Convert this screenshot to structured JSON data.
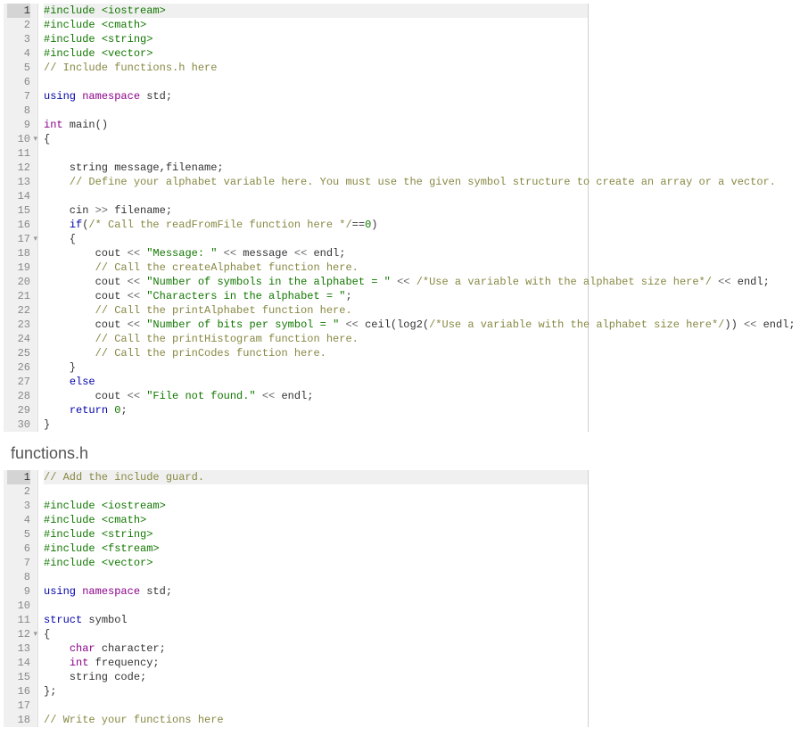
{
  "section2_title": "functions.h",
  "editor1": {
    "lines": [
      {
        "n": "1",
        "active": true,
        "tokens": [
          {
            "t": "#include",
            "c": "pre"
          },
          {
            "t": " "
          },
          {
            "t": "<iostream>",
            "c": "pre"
          }
        ]
      },
      {
        "n": "2",
        "tokens": [
          {
            "t": "#include",
            "c": "pre"
          },
          {
            "t": " "
          },
          {
            "t": "<cmath>",
            "c": "pre"
          }
        ]
      },
      {
        "n": "3",
        "tokens": [
          {
            "t": "#include",
            "c": "pre"
          },
          {
            "t": " "
          },
          {
            "t": "<string>",
            "c": "pre"
          }
        ]
      },
      {
        "n": "4",
        "tokens": [
          {
            "t": "#include",
            "c": "pre"
          },
          {
            "t": " "
          },
          {
            "t": "<vector>",
            "c": "pre"
          }
        ]
      },
      {
        "n": "5",
        "tokens": [
          {
            "t": "// Include functions.h here",
            "c": "cmt"
          }
        ]
      },
      {
        "n": "6",
        "tokens": []
      },
      {
        "n": "7",
        "tokens": [
          {
            "t": "using",
            "c": "kw"
          },
          {
            "t": " "
          },
          {
            "t": "namespace",
            "c": "kw2"
          },
          {
            "t": " std;"
          }
        ]
      },
      {
        "n": "8",
        "tokens": []
      },
      {
        "n": "9",
        "tokens": [
          {
            "t": "int",
            "c": "type"
          },
          {
            "t": " main()"
          }
        ]
      },
      {
        "n": "10",
        "fold": true,
        "tokens": [
          {
            "t": "{"
          }
        ]
      },
      {
        "n": "11",
        "tokens": []
      },
      {
        "n": "12",
        "tokens": [
          {
            "t": "    string message,filename;"
          }
        ]
      },
      {
        "n": "13",
        "tokens": [
          {
            "t": "    "
          },
          {
            "t": "// Define your alphabet variable here. You must use the given symbol structure to create an array or a vector.",
            "c": "cmt"
          }
        ]
      },
      {
        "n": "14",
        "tokens": []
      },
      {
        "n": "15",
        "tokens": [
          {
            "t": "    cin "
          },
          {
            "t": ">>",
            "c": "op"
          },
          {
            "t": " filename;"
          }
        ]
      },
      {
        "n": "16",
        "tokens": [
          {
            "t": "    "
          },
          {
            "t": "if",
            "c": "kw"
          },
          {
            "t": "("
          },
          {
            "t": "/* Call the readFromFile function here */",
            "c": "cmt"
          },
          {
            "t": "=="
          },
          {
            "t": "0",
            "c": "num"
          },
          {
            "t": ")"
          }
        ]
      },
      {
        "n": "17",
        "fold": true,
        "tokens": [
          {
            "t": "    {"
          }
        ]
      },
      {
        "n": "18",
        "tokens": [
          {
            "t": "        cout "
          },
          {
            "t": "<<",
            "c": "op"
          },
          {
            "t": " "
          },
          {
            "t": "\"Message: \"",
            "c": "str"
          },
          {
            "t": " "
          },
          {
            "t": "<<",
            "c": "op"
          },
          {
            "t": " message "
          },
          {
            "t": "<<",
            "c": "op"
          },
          {
            "t": " endl;"
          }
        ]
      },
      {
        "n": "19",
        "tokens": [
          {
            "t": "        "
          },
          {
            "t": "// Call the createAlphabet function here.",
            "c": "cmt"
          }
        ]
      },
      {
        "n": "20",
        "tokens": [
          {
            "t": "        cout "
          },
          {
            "t": "<<",
            "c": "op"
          },
          {
            "t": " "
          },
          {
            "t": "\"Number of symbols in the alphabet = \"",
            "c": "str"
          },
          {
            "t": " "
          },
          {
            "t": "<<",
            "c": "op"
          },
          {
            "t": " "
          },
          {
            "t": "/*Use a variable with the alphabet size here*/",
            "c": "cmt"
          },
          {
            "t": " "
          },
          {
            "t": "<<",
            "c": "op"
          },
          {
            "t": " endl;"
          }
        ]
      },
      {
        "n": "21",
        "tokens": [
          {
            "t": "        cout "
          },
          {
            "t": "<<",
            "c": "op"
          },
          {
            "t": " "
          },
          {
            "t": "\"Characters in the alphabet = \"",
            "c": "str"
          },
          {
            "t": ";"
          }
        ]
      },
      {
        "n": "22",
        "tokens": [
          {
            "t": "        "
          },
          {
            "t": "// Call the printAlphabet function here.",
            "c": "cmt"
          }
        ]
      },
      {
        "n": "23",
        "tokens": [
          {
            "t": "        cout "
          },
          {
            "t": "<<",
            "c": "op"
          },
          {
            "t": " "
          },
          {
            "t": "\"Number of bits per symbol = \"",
            "c": "str"
          },
          {
            "t": " "
          },
          {
            "t": "<<",
            "c": "op"
          },
          {
            "t": " ceil(log2("
          },
          {
            "t": "/*Use a variable with the alphabet size here*/",
            "c": "cmt"
          },
          {
            "t": ")) "
          },
          {
            "t": "<<",
            "c": "op"
          },
          {
            "t": " endl;"
          }
        ]
      },
      {
        "n": "24",
        "tokens": [
          {
            "t": "        "
          },
          {
            "t": "// Call the printHistogram function here.",
            "c": "cmt"
          }
        ]
      },
      {
        "n": "25",
        "tokens": [
          {
            "t": "        "
          },
          {
            "t": "// Call the prinCodes function here.",
            "c": "cmt"
          }
        ]
      },
      {
        "n": "26",
        "tokens": [
          {
            "t": "    }"
          }
        ]
      },
      {
        "n": "27",
        "tokens": [
          {
            "t": "    "
          },
          {
            "t": "else",
            "c": "kw"
          }
        ]
      },
      {
        "n": "28",
        "tokens": [
          {
            "t": "        cout "
          },
          {
            "t": "<<",
            "c": "op"
          },
          {
            "t": " "
          },
          {
            "t": "\"File not found.\"",
            "c": "str"
          },
          {
            "t": " "
          },
          {
            "t": "<<",
            "c": "op"
          },
          {
            "t": " endl;"
          }
        ]
      },
      {
        "n": "29",
        "tokens": [
          {
            "t": "    "
          },
          {
            "t": "return",
            "c": "kw"
          },
          {
            "t": " "
          },
          {
            "t": "0",
            "c": "num"
          },
          {
            "t": ";"
          }
        ]
      },
      {
        "n": "30",
        "tokens": [
          {
            "t": "}"
          }
        ]
      }
    ]
  },
  "editor2": {
    "lines": [
      {
        "n": "1",
        "active": true,
        "tokens": [
          {
            "t": "// Add the include guard.",
            "c": "cmt"
          }
        ]
      },
      {
        "n": "2",
        "tokens": []
      },
      {
        "n": "3",
        "tokens": [
          {
            "t": "#include",
            "c": "pre"
          },
          {
            "t": " "
          },
          {
            "t": "<iostream>",
            "c": "pre"
          }
        ]
      },
      {
        "n": "4",
        "tokens": [
          {
            "t": "#include",
            "c": "pre"
          },
          {
            "t": " "
          },
          {
            "t": "<cmath>",
            "c": "pre"
          }
        ]
      },
      {
        "n": "5",
        "tokens": [
          {
            "t": "#include",
            "c": "pre"
          },
          {
            "t": " "
          },
          {
            "t": "<string>",
            "c": "pre"
          }
        ]
      },
      {
        "n": "6",
        "tokens": [
          {
            "t": "#include",
            "c": "pre"
          },
          {
            "t": " "
          },
          {
            "t": "<fstream>",
            "c": "pre"
          }
        ]
      },
      {
        "n": "7",
        "tokens": [
          {
            "t": "#include",
            "c": "pre"
          },
          {
            "t": " "
          },
          {
            "t": "<vector>",
            "c": "pre"
          }
        ]
      },
      {
        "n": "8",
        "tokens": []
      },
      {
        "n": "9",
        "tokens": [
          {
            "t": "using",
            "c": "kw"
          },
          {
            "t": " "
          },
          {
            "t": "namespace",
            "c": "kw2"
          },
          {
            "t": " std;"
          }
        ]
      },
      {
        "n": "10",
        "tokens": []
      },
      {
        "n": "11",
        "tokens": [
          {
            "t": "struct",
            "c": "kw"
          },
          {
            "t": " symbol"
          }
        ]
      },
      {
        "n": "12",
        "fold": true,
        "tokens": [
          {
            "t": "{"
          }
        ]
      },
      {
        "n": "13",
        "tokens": [
          {
            "t": "    "
          },
          {
            "t": "char",
            "c": "type"
          },
          {
            "t": " character;"
          }
        ]
      },
      {
        "n": "14",
        "tokens": [
          {
            "t": "    "
          },
          {
            "t": "int",
            "c": "type"
          },
          {
            "t": " frequency;"
          }
        ]
      },
      {
        "n": "15",
        "tokens": [
          {
            "t": "    string code;"
          }
        ]
      },
      {
        "n": "16",
        "tokens": [
          {
            "t": "};"
          }
        ]
      },
      {
        "n": "17",
        "tokens": []
      },
      {
        "n": "18",
        "tokens": [
          {
            "t": "// Write your functions here",
            "c": "cmt"
          }
        ]
      }
    ]
  }
}
